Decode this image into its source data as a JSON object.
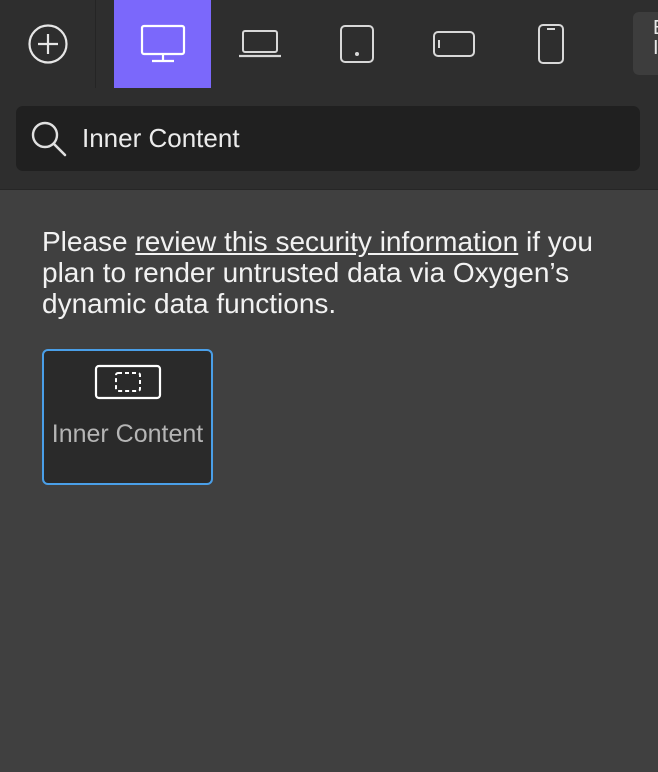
{
  "toolbar": {
    "add_icon": "plus-circle-icon",
    "devices": [
      {
        "name": "desktop",
        "icon": "desktop-monitor-icon",
        "active": true
      },
      {
        "name": "laptop",
        "icon": "laptop-icon",
        "active": false
      },
      {
        "name": "tablet",
        "icon": "tablet-portrait-icon",
        "active": false
      },
      {
        "name": "phone-landscape",
        "icon": "phone-landscape-icon",
        "active": false
      },
      {
        "name": "phone-portrait",
        "icon": "phone-portrait-icon",
        "active": false
      }
    ],
    "overflow_label": "E\nI",
    "active_color": "#7b68fb"
  },
  "search": {
    "icon": "search-icon",
    "value": "Inner Content"
  },
  "notice": {
    "prefix": "Please ",
    "link_text": "review this security information",
    "suffix": " if you plan to render untrusted data via Oxygen’s dynamic data functions."
  },
  "results": [
    {
      "label": "Inner Content",
      "icon": "inner-content-icon",
      "selected": true,
      "border_color": "#4a9fe8"
    }
  ],
  "colors": {
    "background": "#404040",
    "topbar": "#2e2e2e",
    "search_bg": "#202020"
  }
}
